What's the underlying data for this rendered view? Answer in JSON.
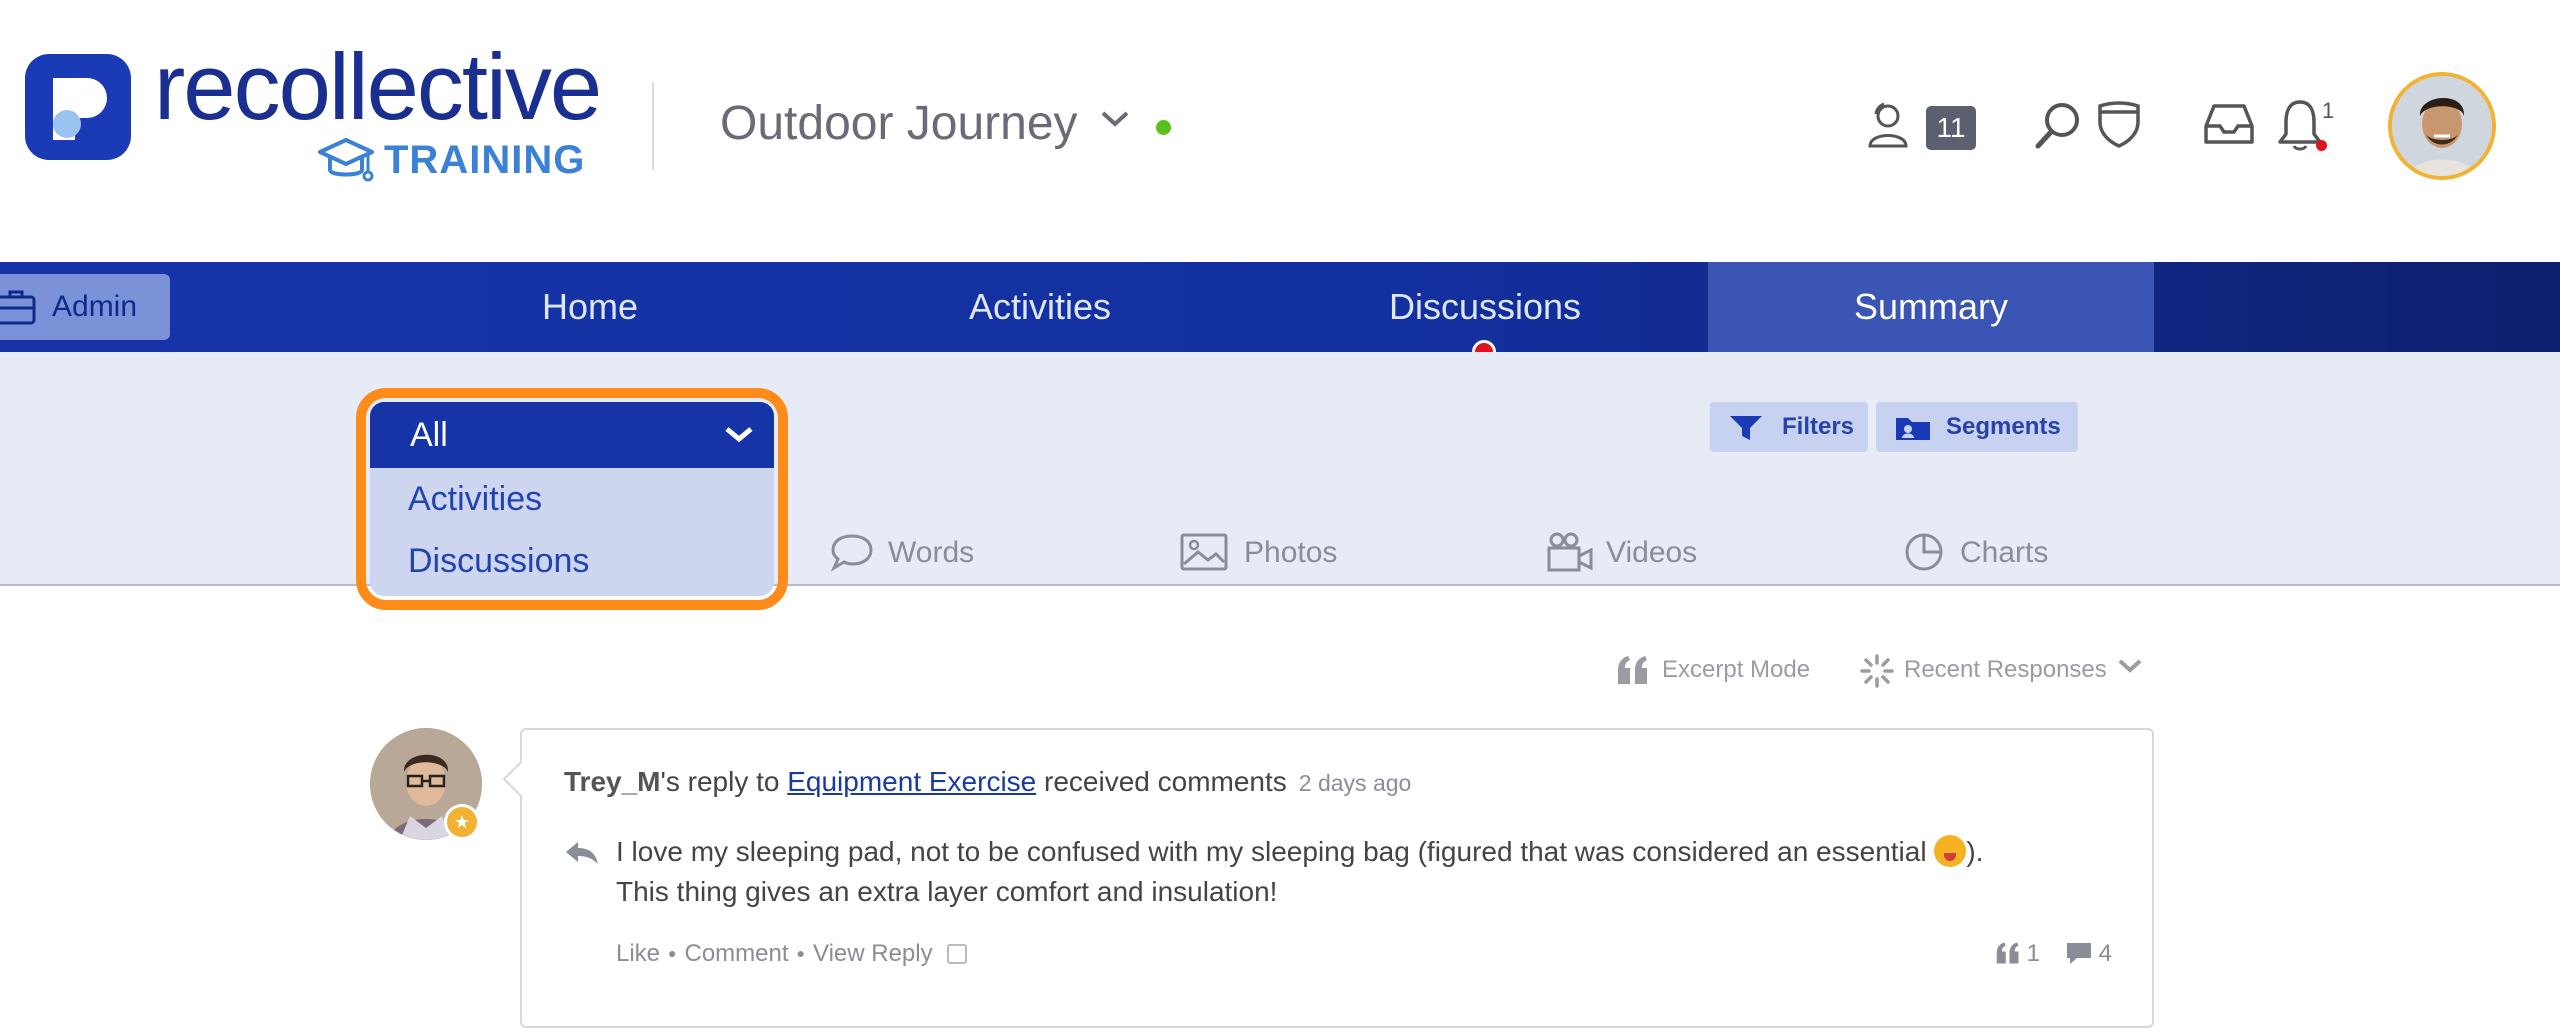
{
  "brand": {
    "name": "recollective",
    "sub": "TRAINING",
    "color": "#1a3bb5"
  },
  "project": {
    "name": "Outdoor Journey",
    "status_color": "#59c11a"
  },
  "header": {
    "online_users": "11",
    "notifications": "1"
  },
  "nav": {
    "admin": "Admin",
    "items": [
      {
        "label": "Home"
      },
      {
        "label": "Activities"
      },
      {
        "label": "Discussions"
      },
      {
        "label": "Summary",
        "active": true
      }
    ]
  },
  "toolbar": {
    "filters": "Filters",
    "segments": "Segments",
    "dropdown": {
      "selected": "All",
      "options": [
        "Activities",
        "Discussions"
      ]
    },
    "tabs": [
      "Words",
      "Photos",
      "Videos",
      "Charts"
    ]
  },
  "sort": {
    "excerpt": "Excerpt Mode",
    "recent": "Recent Responses"
  },
  "post": {
    "author": "Trey_M",
    "reply_to": "'s reply to ",
    "link": "Equipment Exercise",
    "action": " received comments",
    "time": "2 days ago",
    "body_1": "I love my sleeping pad, not to be confused with my sleeping bag (figured that was considered an essential ",
    "body_2": ").",
    "body_3": "This thing gives an extra layer comfort and insulation!",
    "like": "Like",
    "comment": "Comment",
    "view_reply": "View Reply",
    "quotes": "1",
    "comments": "4"
  },
  "colors": {
    "highlight": "#ff8c1a",
    "nav": "#1634a8",
    "accent_dot": "#e0121c"
  }
}
